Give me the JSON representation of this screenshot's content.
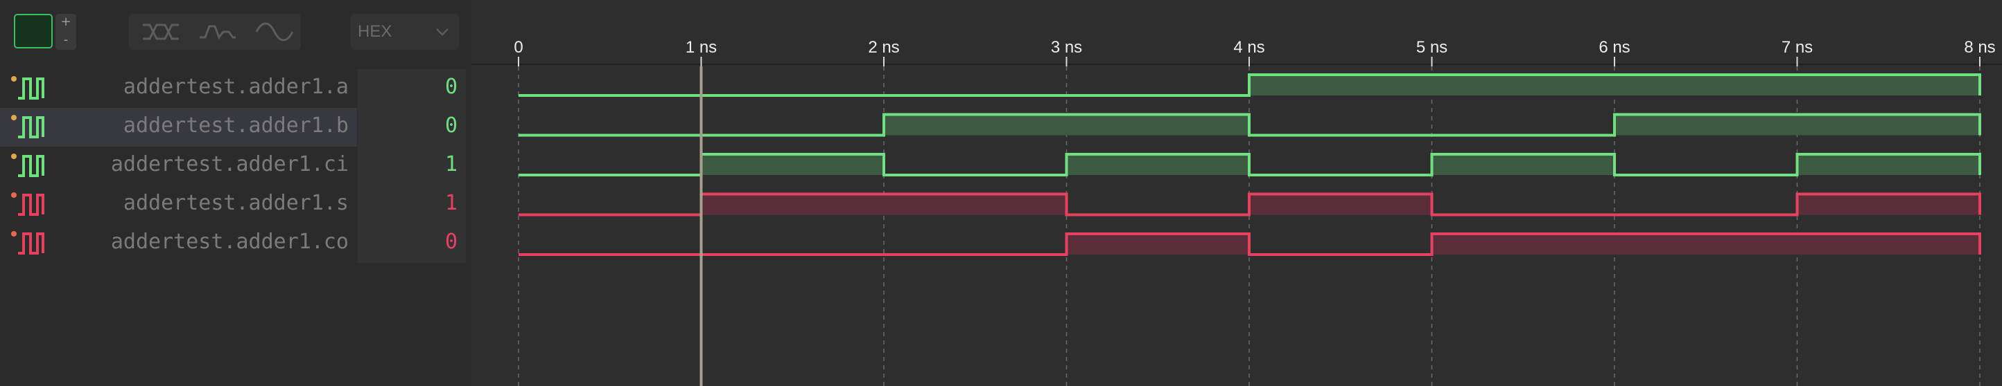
{
  "toolbar": {
    "zoom_in_label": "+",
    "zoom_out_label": "-",
    "render_modes": [
      "bus-icon",
      "step-icon",
      "analog-icon"
    ],
    "format_value": "HEX"
  },
  "ruler": {
    "ticks": [
      "0",
      "1 ns",
      "2 ns",
      "3 ns",
      "4 ns",
      "5 ns",
      "6 ns",
      "7 ns",
      "8 ns"
    ]
  },
  "cursor_time_ns": 1,
  "colors": {
    "input": "#6ee07f",
    "input_fill": "#3d5a42",
    "output": "#e8415f",
    "output_fill": "#5a2e38",
    "cursor": "#a89e8c"
  },
  "signals": [
    {
      "name": "addertest.adder1.a",
      "value": "0",
      "kind": "input",
      "selected": false
    },
    {
      "name": "addertest.adder1.b",
      "value": "0",
      "kind": "input",
      "selected": true
    },
    {
      "name": "addertest.adder1.ci",
      "value": "1",
      "kind": "input",
      "selected": false
    },
    {
      "name": "addertest.adder1.s",
      "value": "1",
      "kind": "output",
      "selected": false
    },
    {
      "name": "addertest.adder1.co",
      "value": "0",
      "kind": "output",
      "selected": false
    }
  ],
  "waveforms": [
    {
      "signal": "addertest.adder1.a",
      "levels": [
        0,
        0,
        0,
        0,
        1,
        1,
        1,
        1
      ]
    },
    {
      "signal": "addertest.adder1.b",
      "levels": [
        0,
        0,
        1,
        1,
        0,
        0,
        1,
        1
      ]
    },
    {
      "signal": "addertest.adder1.ci",
      "levels": [
        0,
        1,
        0,
        1,
        0,
        1,
        0,
        1
      ]
    },
    {
      "signal": "addertest.adder1.s",
      "levels": [
        0,
        1,
        1,
        0,
        1,
        0,
        0,
        1
      ]
    },
    {
      "signal": "addertest.adder1.co",
      "levels": [
        0,
        0,
        0,
        1,
        0,
        1,
        1,
        1
      ]
    }
  ]
}
